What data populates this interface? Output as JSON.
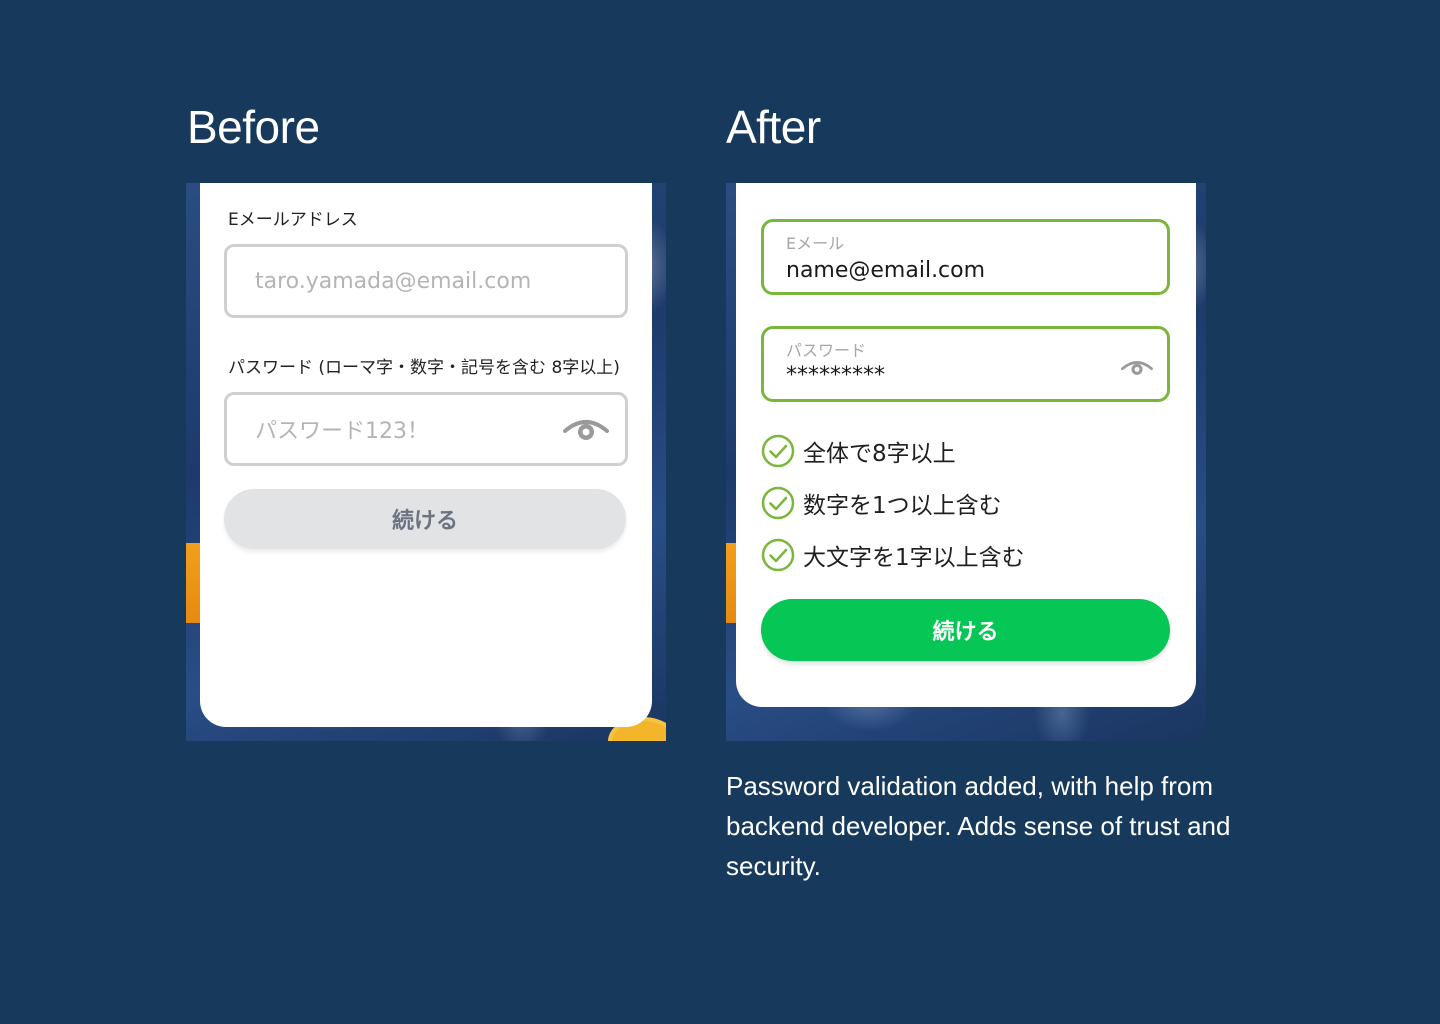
{
  "before": {
    "title": "Before",
    "email_label": "Eメールアドレス",
    "email_placeholder": "taro.yamada@email.com",
    "password_label": "パスワード (ローマ字・数字・記号を含む 8字以上)",
    "password_placeholder": "パスワード123！",
    "eye_icon": "eye-icon",
    "continue_label": "続ける",
    "button_color": "#e2e3e5"
  },
  "after": {
    "title": "After",
    "email_label": "Eメール",
    "email_value": "name@email.com",
    "password_label": "パスワード",
    "password_value": "*********",
    "eye_icon": "eye-icon",
    "rules": [
      {
        "text": "全体で8字以上",
        "icon": "check-circle-icon"
      },
      {
        "text": "数字を1つ以上含む",
        "icon": "check-circle-icon"
      },
      {
        "text": "大文字を1字以上含む",
        "icon": "check-circle-icon"
      }
    ],
    "continue_label": "続ける",
    "accent_color": "#7ab63b",
    "button_color": "#06c755"
  },
  "caption": "Password validation added, with help from backend developer. Adds sense of trust and security.",
  "background_color": "#173a5c"
}
